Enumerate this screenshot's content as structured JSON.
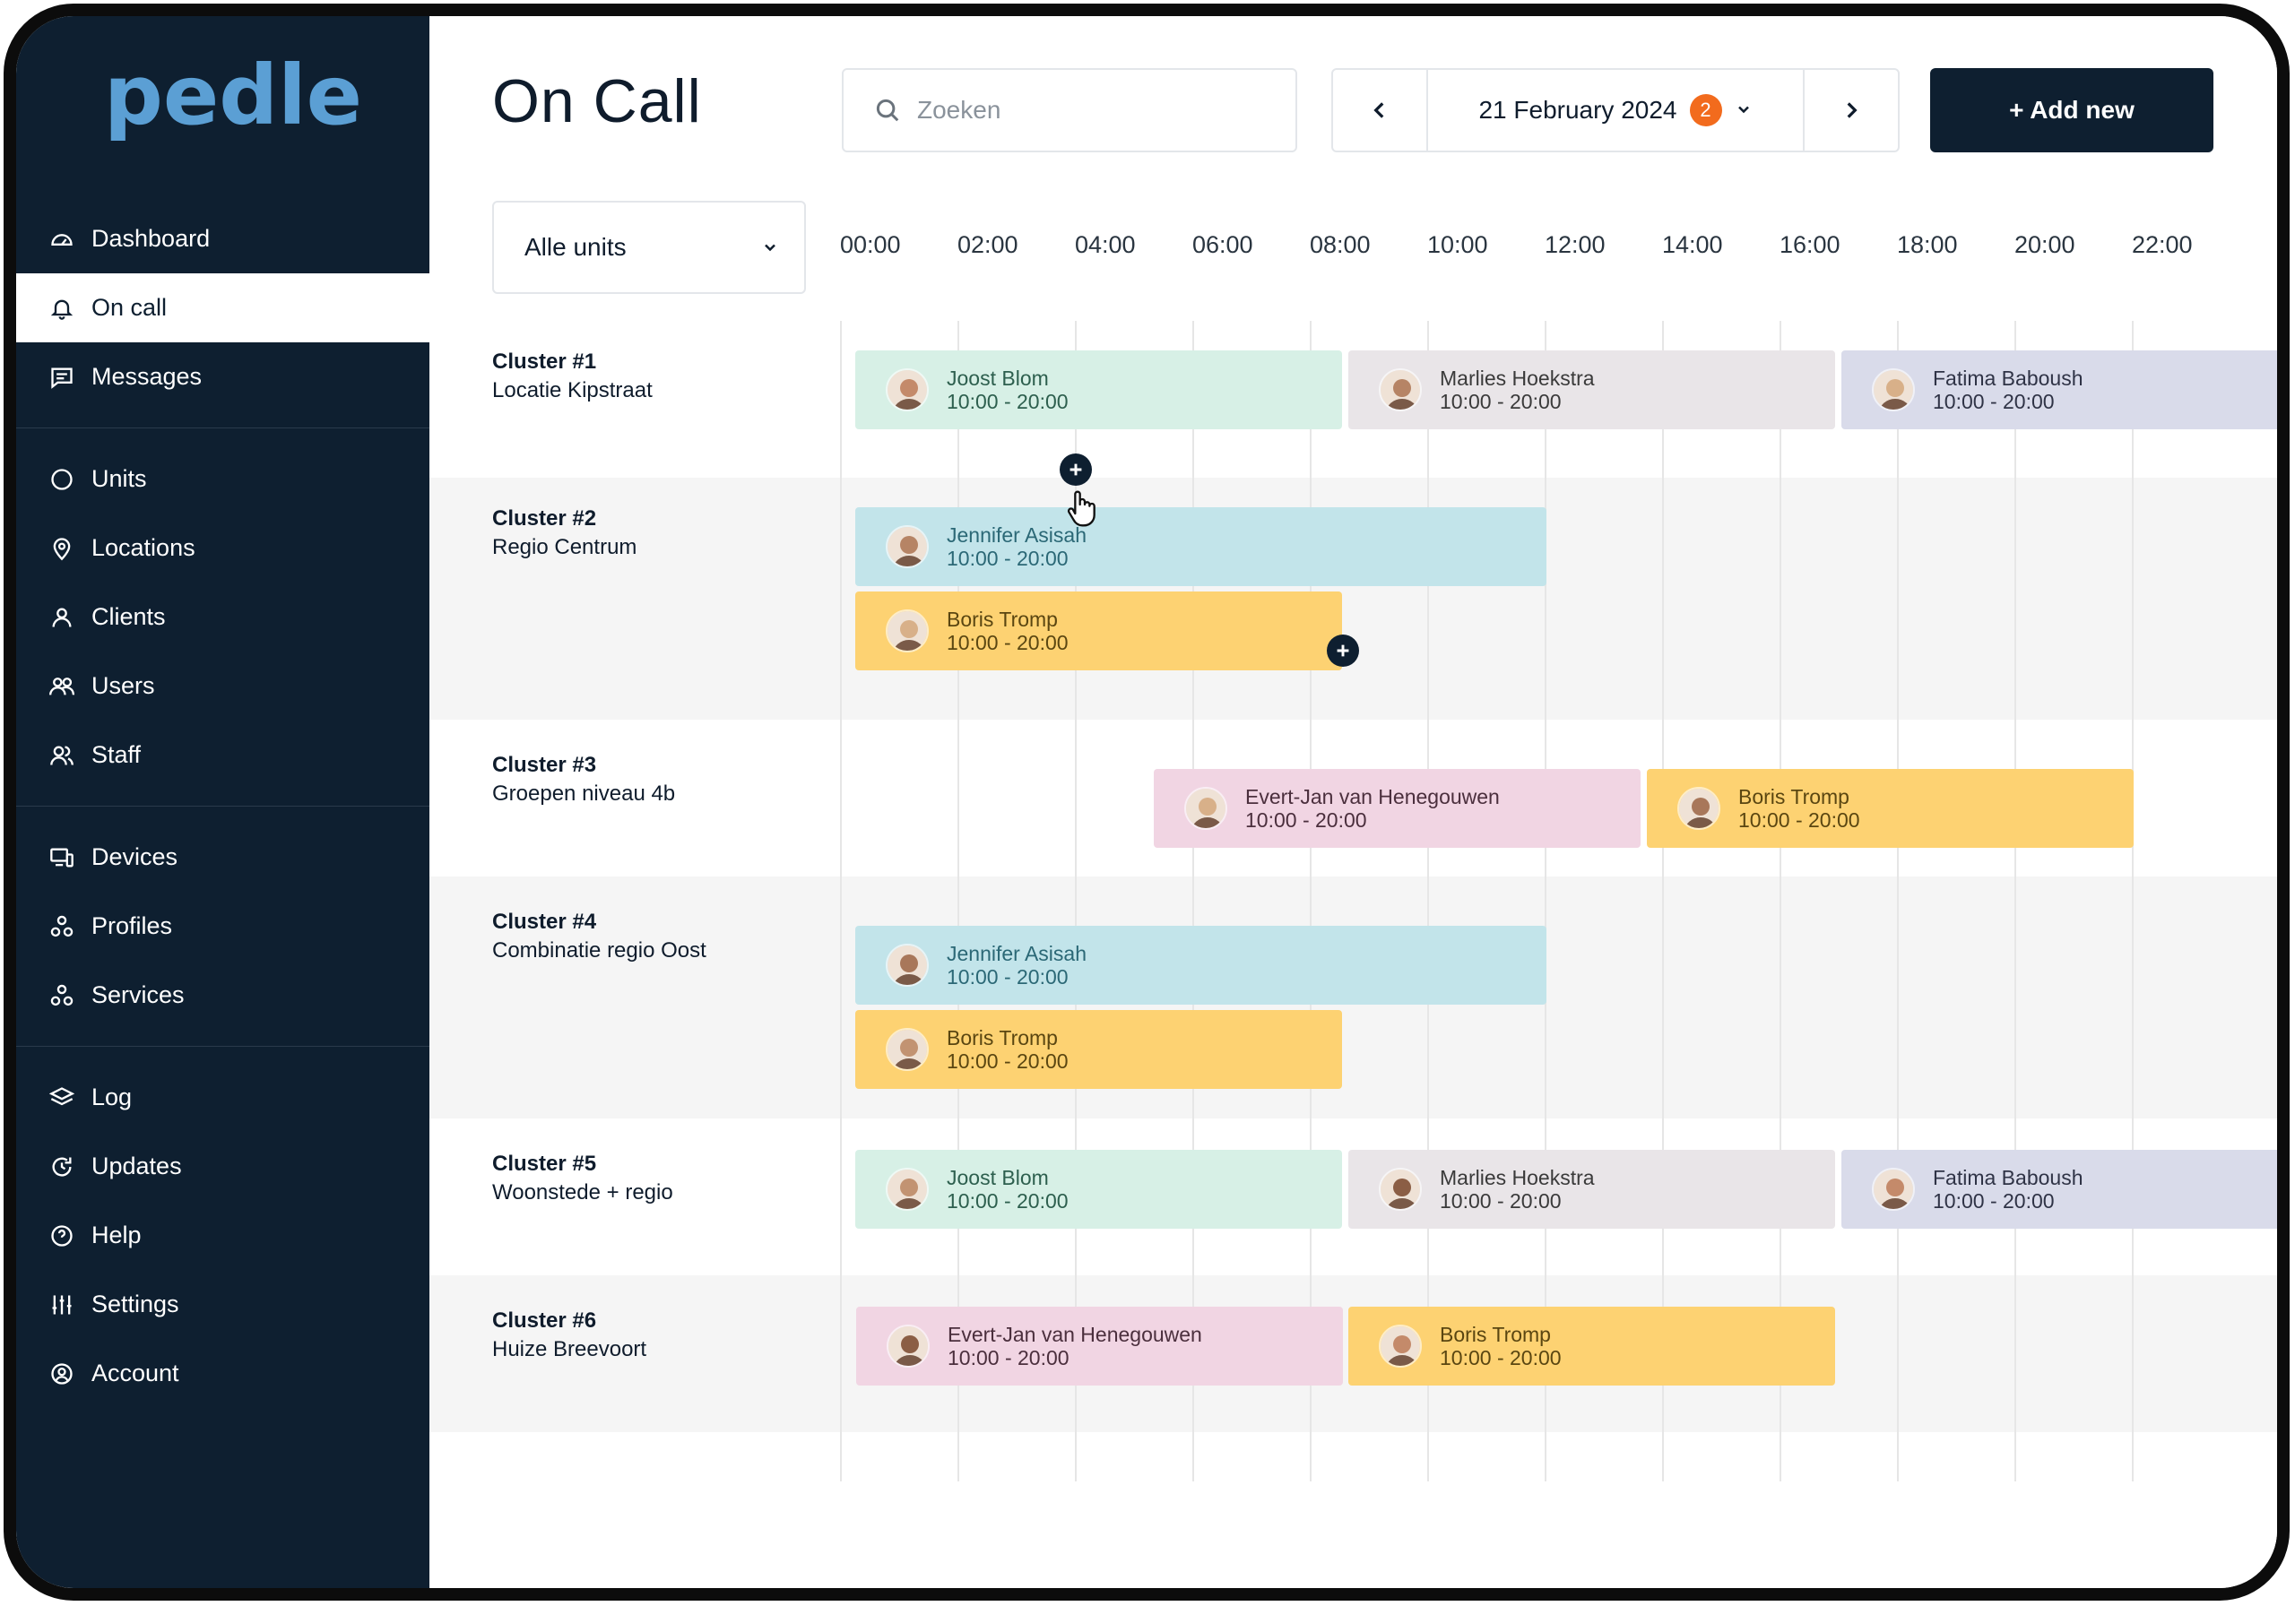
{
  "brand": {
    "name": "pedle",
    "color": "#5b9fd4"
  },
  "colors": {
    "sidebar_bg": "#0e1f30",
    "accent_dark": "#0e1f30",
    "badge": "#f26b1d",
    "shift_green": "#d7f0e6",
    "shift_grey": "#e9e5e8",
    "shift_lavender": "#d9dbea",
    "shift_blue": "#c2e4ea",
    "shift_yellow": "#fdd272",
    "shift_pink": "#f1d5e3"
  },
  "sidebar": {
    "items": [
      {
        "label": "Dashboard",
        "icon": "dashboard-icon"
      },
      {
        "label": "On call",
        "icon": "bell-icon",
        "active": true
      },
      {
        "label": "Messages",
        "icon": "message-icon"
      },
      {
        "label": "Units",
        "icon": "circle-icon"
      },
      {
        "label": "Locations",
        "icon": "map-pin-icon"
      },
      {
        "label": "Clients",
        "icon": "user-icon"
      },
      {
        "label": "Users",
        "icon": "users-icon"
      },
      {
        "label": "Staff",
        "icon": "staff-icon"
      },
      {
        "label": "Devices",
        "icon": "devices-icon"
      },
      {
        "label": "Profiles",
        "icon": "profiles-icon"
      },
      {
        "label": "Services",
        "icon": "services-icon"
      },
      {
        "label": "Log",
        "icon": "layers-icon"
      },
      {
        "label": "Updates",
        "icon": "refresh-icon"
      },
      {
        "label": "Help",
        "icon": "help-icon"
      },
      {
        "label": "Settings",
        "icon": "sliders-icon"
      },
      {
        "label": "Account",
        "icon": "account-icon"
      }
    ]
  },
  "header": {
    "title": "On Call",
    "search_placeholder": "Zoeken",
    "date": "21 February 2024",
    "date_badge": "2",
    "add_label": "+ Add new"
  },
  "filter": {
    "units_value": "Alle units"
  },
  "hours": [
    "00:00",
    "02:00",
    "04:00",
    "06:00",
    "08:00",
    "10:00",
    "12:00",
    "14:00",
    "16:00",
    "18:00",
    "20:00",
    "22:00"
  ],
  "rows": [
    {
      "title": "Cluster #1",
      "subtitle": "Locatie Kipstraat",
      "shifts": [
        {
          "name": "Joost Blom",
          "time": "10:00 - 20:00",
          "color": "green"
        },
        {
          "name": "Marlies Hoekstra",
          "time": "10:00 - 20:00",
          "color": "grey"
        },
        {
          "name": "Fatima Baboush",
          "time": "10:00 - 20:00",
          "color": "lavender"
        }
      ]
    },
    {
      "title": "Cluster #2",
      "subtitle": "Regio Centrum",
      "shifts": [
        {
          "name": "Jennifer Asisah",
          "time": "10:00 - 20:00",
          "color": "blue"
        },
        {
          "name": "Boris Tromp",
          "time": "10:00 - 20:00",
          "color": "yellow"
        }
      ]
    },
    {
      "title": "Cluster #3",
      "subtitle": "Groepen niveau 4b",
      "shifts": [
        {
          "name": "Evert-Jan van Henegouwen",
          "time": "10:00 - 20:00",
          "color": "pink"
        },
        {
          "name": "Boris Tromp",
          "time": "10:00 - 20:00",
          "color": "yellow"
        }
      ]
    },
    {
      "title": "Cluster #4",
      "subtitle": "Combinatie regio Oost",
      "shifts": [
        {
          "name": "Jennifer Asisah",
          "time": "10:00 - 20:00",
          "color": "blue"
        },
        {
          "name": "Boris Tromp",
          "time": "10:00 - 20:00",
          "color": "yellow"
        }
      ]
    },
    {
      "title": "Cluster #5",
      "subtitle": "Woonstede + regio",
      "shifts": [
        {
          "name": "Joost Blom",
          "time": "10:00 - 20:00",
          "color": "green"
        },
        {
          "name": "Marlies Hoekstra",
          "time": "10:00 - 20:00",
          "color": "grey"
        },
        {
          "name": "Fatima Baboush",
          "time": "10:00 - 20:00",
          "color": "lavender"
        }
      ]
    },
    {
      "title": "Cluster #6",
      "subtitle": "Huize Breevoort",
      "shifts": [
        {
          "name": "Evert-Jan van Henegouwen",
          "time": "10:00 - 20:00",
          "color": "pink"
        },
        {
          "name": "Boris Tromp",
          "time": "10:00 - 20:00",
          "color": "yellow"
        }
      ]
    }
  ]
}
